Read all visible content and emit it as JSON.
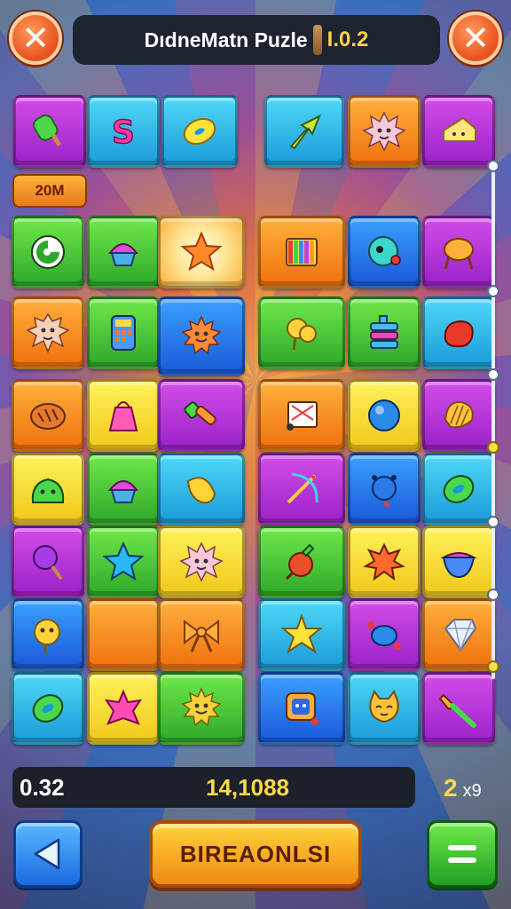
{
  "header": {
    "title": "DıdneMatn Puzle",
    "version": "I.0.2",
    "close_left_glyph": "✕",
    "close_right_glyph": "✕"
  },
  "board": {
    "tag_label": "20M",
    "rows": [
      [
        "popsicle",
        "dollar",
        "donut",
        "arrow-plant",
        "spiky-face",
        "cheese"
      ],
      [
        "swirl",
        "cupcake",
        "star",
        "book-stack",
        "robot-face",
        "drum"
      ],
      [
        "lion-face",
        "calculator",
        "sun-face",
        "balloon-heart",
        "battery",
        "jelly"
      ],
      [
        "bread",
        "gift-bag",
        "hammer",
        "music-sheet",
        "ball",
        "shell"
      ],
      [
        "slime",
        "cupcake",
        "lemon",
        "bow-arrow",
        "beetle",
        "ring"
      ],
      [
        "lollipop",
        "star",
        "spiky-face",
        "tomato",
        "splat",
        "bowl"
      ],
      [
        "sun-face",
        "empty",
        "bow",
        "starfish",
        "crab",
        "diamond"
      ],
      [
        "ring",
        "starfish",
        "sun-face",
        "frame-monster",
        "cat-face",
        "fork"
      ]
    ]
  },
  "score": {
    "left_value": "0.32",
    "center_value": "14,1088",
    "multiplier": "2",
    "multiplier_suffix": "x9"
  },
  "buttons": {
    "main_label": "BIREAONLSI"
  },
  "colors": {
    "accent_orange": "#f08a12",
    "score_yellow": "#ffd84a",
    "panel_dark": "#1c2028"
  }
}
